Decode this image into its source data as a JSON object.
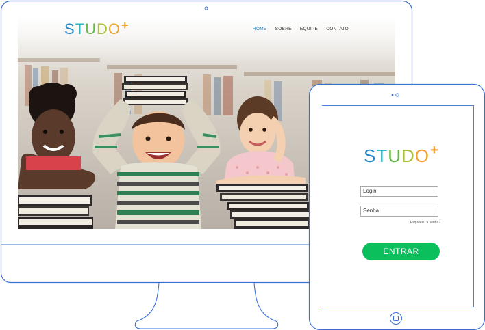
{
  "website": {
    "logo": {
      "s": "S",
      "t": "T",
      "u": "U",
      "d": "D",
      "o": "O",
      "plus": "+"
    },
    "nav": [
      {
        "label": "HOME",
        "active": true
      },
      {
        "label": "SOBRE",
        "active": false
      },
      {
        "label": "EQUIPE",
        "active": false
      },
      {
        "label": "CONTATO",
        "active": false
      }
    ],
    "hero_image": "children-holding-books-in-library"
  },
  "tablet_app": {
    "logo": {
      "s": "S",
      "t": "T",
      "u": "U",
      "d": "D",
      "o": "O",
      "plus": "+"
    },
    "login_value": "Login",
    "password_value": "Senha",
    "forgot_password": "Esqueceu a senha?",
    "enter_button": "ENTRAR"
  },
  "colors": {
    "device_outline": "#3a6fd6",
    "logo_blue": "#1e88c8",
    "logo_teal": "#2db5c3",
    "logo_green": "#64b647",
    "logo_lime": "#a7c23a",
    "logo_orange": "#f0a22a",
    "nav_active": "#1e88c8",
    "button_green": "#0bbf5c"
  }
}
